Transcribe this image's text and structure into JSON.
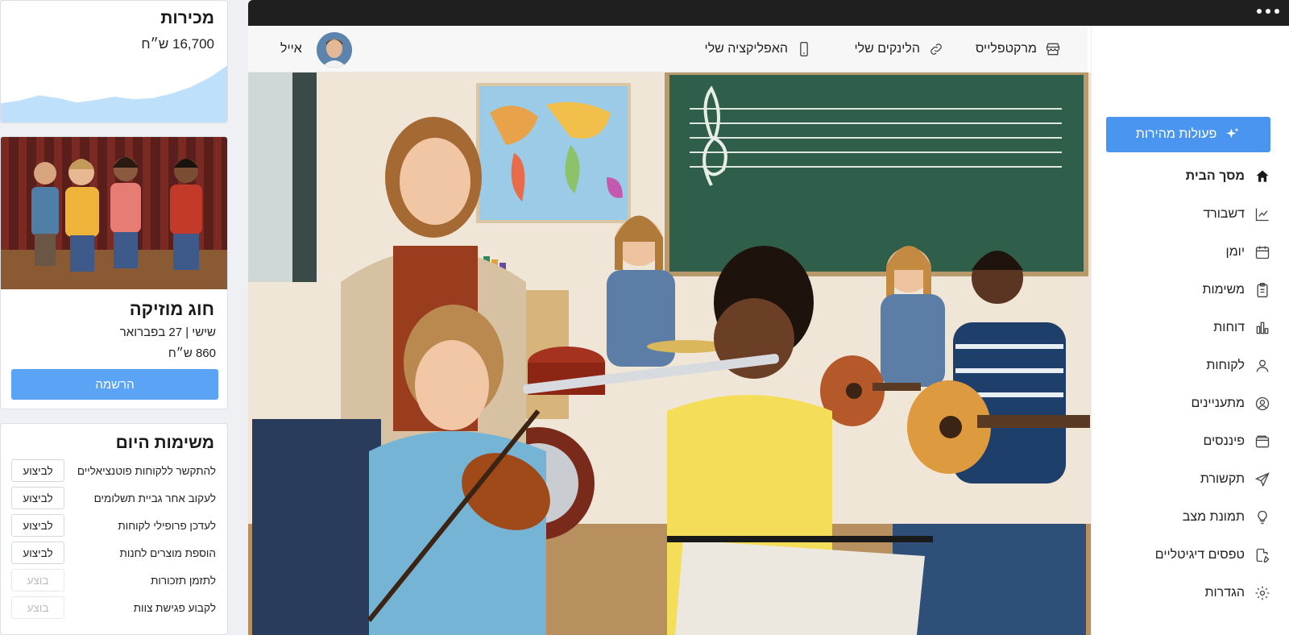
{
  "sales": {
    "title": "מכירות",
    "amount": "16,700 ש״ח",
    "trend": [
      0.3,
      0.34,
      0.42,
      0.38,
      0.31,
      0.35,
      0.4,
      0.36,
      0.38,
      0.45,
      0.55,
      0.7,
      0.9
    ]
  },
  "event": {
    "image": "children-singing-stage-photo",
    "title": "חוג מוזיקה",
    "date": "שישי | 27 בפברואר",
    "price": "860 ש״ח",
    "register_label": "הרשמה"
  },
  "tasks": {
    "title": "משימות היום",
    "items": [
      {
        "label": "להתקשר ללקוחות פוטנציאליים",
        "action": "לביצוע",
        "done": false
      },
      {
        "label": "לעקוב אחר גביית תשלומים",
        "action": "לביצוע",
        "done": false
      },
      {
        "label": "לעדכן פרופילי לקוחות",
        "action": "לביצוע",
        "done": false
      },
      {
        "label": "הוספת מוצרים לחנות",
        "action": "לביצוע",
        "done": false
      },
      {
        "label": "לתזמן תזכורות",
        "action": "בוצע",
        "done": true
      },
      {
        "label": "לקבוע פגישת צוות",
        "action": "בוצע",
        "done": true
      }
    ]
  },
  "topnav": {
    "marketplace": "מרקטפלייס",
    "links": "הלינקים שלי",
    "app": "האפליקציה שלי",
    "user_name": "אייל"
  },
  "hero": {
    "image": "music-class-photo"
  },
  "sidebar": {
    "quick_actions": "פעולות מהירות",
    "items": [
      {
        "label": "מסך הבית",
        "icon": "home-icon",
        "active": true
      },
      {
        "label": "דשבורד",
        "icon": "chart-line-icon",
        "active": false
      },
      {
        "label": "יומן",
        "icon": "calendar-icon",
        "active": false
      },
      {
        "label": "משימות",
        "icon": "clipboard-icon",
        "active": false
      },
      {
        "label": "דוחות",
        "icon": "bar-chart-icon",
        "active": false
      },
      {
        "label": "לקוחות",
        "icon": "user-icon",
        "active": false
      },
      {
        "label": "מתעניינים",
        "icon": "user-circle-icon",
        "active": false
      },
      {
        "label": "פיננסים",
        "icon": "wallet-icon",
        "active": false
      },
      {
        "label": "תקשורת",
        "icon": "send-icon",
        "active": false
      },
      {
        "label": "תמונת מצב",
        "icon": "lightbulb-icon",
        "active": false
      },
      {
        "label": "טפסים דיגיטליים",
        "icon": "file-edit-icon",
        "active": false
      },
      {
        "label": "הגדרות",
        "icon": "gear-icon",
        "active": false
      }
    ]
  },
  "colors": {
    "accent": "#4a95ef",
    "register": "#5aa3f5",
    "chart_fill": "#bfe0fb"
  }
}
